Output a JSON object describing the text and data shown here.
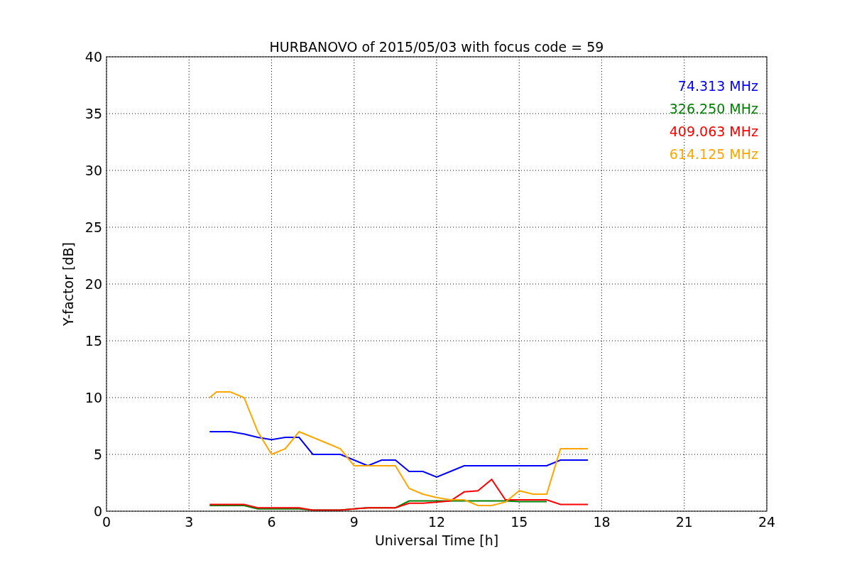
{
  "chart_data": {
    "type": "line",
    "title": "HURBANOVO of 2015/05/03 with focus code = 59",
    "xlabel": "Universal Time [h]",
    "ylabel": "Y-factor [dB]",
    "x": [
      3.75,
      4,
      4.5,
      5,
      5.5,
      6,
      6.5,
      7,
      7.5,
      8,
      8.5,
      9,
      9.5,
      10,
      10.5,
      11,
      11.5,
      12,
      12.5,
      13,
      13.5,
      14,
      14.5,
      15,
      15.5,
      16,
      16.5,
      17,
      17.5
    ],
    "series": [
      {
        "name": "74.313 MHz",
        "color": "#0000ff",
        "values": [
          7,
          7,
          7,
          6.8,
          6.5,
          6.3,
          6.5,
          6.5,
          5,
          5,
          5,
          4.5,
          4,
          4.5,
          4.5,
          3.5,
          3.5,
          3,
          3.5,
          4,
          4,
          4,
          4,
          4,
          4,
          4,
          4.5,
          4.5,
          4.5
        ]
      },
      {
        "name": "326.250 MHz",
        "color": "#008000",
        "values": [
          0.5,
          0.5,
          0.5,
          0.5,
          0.2,
          0.2,
          0.2,
          0.2,
          0.1,
          0.1,
          0.1,
          0.2,
          0.3,
          0.3,
          0.3,
          0.9,
          0.9,
          0.9,
          0.9,
          0.9,
          0.9,
          0.9,
          0.9,
          0.85,
          0.85,
          0.85,
          null,
          null,
          null
        ]
      },
      {
        "name": "409.063 MHz",
        "color": "#ff0000",
        "values": [
          0.6,
          0.6,
          0.6,
          0.6,
          0.3,
          0.3,
          0.3,
          0.3,
          0.1,
          0.1,
          0.1,
          0.2,
          0.3,
          0.3,
          0.3,
          0.7,
          0.7,
          0.8,
          0.9,
          1.7,
          1.8,
          2.8,
          1,
          1,
          1,
          1,
          0.6,
          0.6,
          0.6
        ]
      },
      {
        "name": "614.125 MHz",
        "color": "#ffa500",
        "values": [
          10,
          10.5,
          10.5,
          10,
          7,
          5,
          5.5,
          7,
          6.5,
          6,
          5.5,
          4,
          4,
          4,
          4,
          2,
          1.5,
          1.2,
          1,
          1,
          0.5,
          0.5,
          0.8,
          1.8,
          1.5,
          1.5,
          5.5,
          5.5,
          5.5
        ]
      }
    ],
    "xlim": [
      0,
      24
    ],
    "ylim": [
      0,
      40
    ],
    "xticks": [
      0,
      3,
      6,
      9,
      12,
      15,
      18,
      21,
      24
    ],
    "yticks": [
      0,
      5,
      10,
      15,
      20,
      25,
      30,
      35,
      40
    ],
    "grid": true
  }
}
